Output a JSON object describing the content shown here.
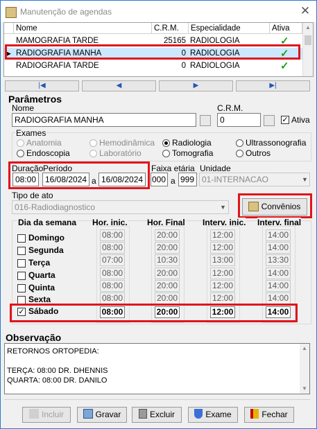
{
  "window": {
    "title": "Manutenção de agendas",
    "close_glyph": "✕"
  },
  "grid": {
    "headers": [
      "Nome",
      "C.R.M.",
      "Especialidade",
      "Ativa"
    ],
    "rows": [
      {
        "nome": "MAMOGRAFIA TARDE",
        "crm": "25165",
        "especialidade": "RADIOLOGIA",
        "ativa": "✓",
        "selected": false
      },
      {
        "nome": "RADIOGRAFIA MANHA",
        "crm": "0",
        "especialidade": "RADIOLOGIA",
        "ativa": "✓",
        "selected": true
      },
      {
        "nome": "RADIOGRAFIA TARDE",
        "crm": "0",
        "especialidade": "RADIOLOGIA",
        "ativa": "✓",
        "selected": false
      }
    ],
    "row_indicator": "▶",
    "check_color": "#1ca11c",
    "selection_color": "#cce8ff"
  },
  "nav": {
    "first": "|◀",
    "prev": "◀",
    "next": "▶",
    "last": "▶|"
  },
  "params": {
    "section_title": "Parâmetros",
    "nome_label": "Nome",
    "nome_value": "RADIOGRAFIA MANHA",
    "crm_label": "C.R.M.",
    "crm_value": "0",
    "ativa_label": "Ativa",
    "ativa_checked": true
  },
  "exames": {
    "label": "Exames",
    "options": [
      {
        "label": "Anatomia",
        "enabled": false,
        "checked": false
      },
      {
        "label": "Hemodinâmica",
        "enabled": false,
        "checked": false
      },
      {
        "label": "Radiologia",
        "enabled": true,
        "checked": true
      },
      {
        "label": "Ultrassonografia",
        "enabled": true,
        "checked": false
      },
      {
        "label": "Endoscopia",
        "enabled": true,
        "checked": false
      },
      {
        "label": "Laboratório",
        "enabled": false,
        "checked": false
      },
      {
        "label": "Tomografia",
        "enabled": true,
        "checked": false
      },
      {
        "label": "Outros",
        "enabled": true,
        "checked": false
      }
    ]
  },
  "duracao": {
    "label": "Duração",
    "value": "08:00"
  },
  "periodo": {
    "label": "Período",
    "start": "16/08/2024",
    "sep": "a",
    "end": "16/08/2024"
  },
  "faixa": {
    "label": "Faixa etária",
    "min": "000",
    "sep": "a",
    "max": "999"
  },
  "unidade": {
    "label": "Unidade",
    "value": "01-INTERNACAO"
  },
  "tipo_ato": {
    "label": "Tipo de ato",
    "value": "016-Radiodiagnostico"
  },
  "convenios_button": "Convênios",
  "schedule": {
    "headers": {
      "dia": "Dia da semana",
      "hini": "Hor. inic.",
      "hfim": "Hor. Final",
      "iini": "Interv. inic.",
      "ifim": "Interv. final"
    },
    "days": [
      {
        "dia": "Domingo",
        "checked": false,
        "hini": "08:00",
        "hfim": "20:00",
        "iini": "12:00",
        "ifim": "14:00"
      },
      {
        "dia": "Segunda",
        "checked": false,
        "hini": "08:00",
        "hfim": "20:00",
        "iini": "12:00",
        "ifim": "14:00"
      },
      {
        "dia": "Terça",
        "checked": false,
        "hini": "07:00",
        "hfim": "10:30",
        "iini": "13:00",
        "ifim": "13:30"
      },
      {
        "dia": "Quarta",
        "checked": false,
        "hini": "08:00",
        "hfim": "20:00",
        "iini": "12:00",
        "ifim": "14:00"
      },
      {
        "dia": "Quinta",
        "checked": false,
        "hini": "08:00",
        "hfim": "20:00",
        "iini": "12:00",
        "ifim": "14:00"
      },
      {
        "dia": "Sexta",
        "checked": false,
        "hini": "08:00",
        "hfim": "20:00",
        "iini": "12:00",
        "ifim": "14:00"
      },
      {
        "dia": "Sábado",
        "checked": true,
        "hini": "08:00",
        "hfim": "20:00",
        "iini": "12:00",
        "ifim": "14:00"
      }
    ]
  },
  "observacao": {
    "label": "Observação",
    "lines": [
      "RETORNOS ORTOPEDIA:",
      "",
      "TERÇA: 08:00 DR. DHENNIS",
      "QUARTA: 08:00 DR. DANILO"
    ]
  },
  "buttons": {
    "incluir": "Incluir",
    "gravar": "Gravar",
    "excluir": "Excluir",
    "exame": "Exame",
    "fechar": "Fechar"
  },
  "colors": {
    "highlight_red": "#e0141b",
    "accent_blue": "#2456b4"
  }
}
